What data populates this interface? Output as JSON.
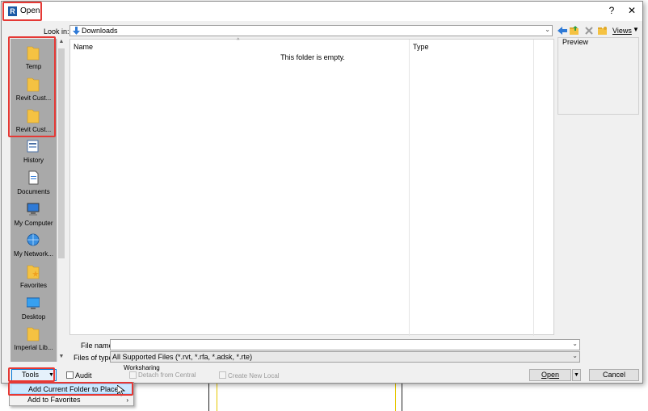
{
  "dialog": {
    "title": "Open",
    "app_icon_letter": "R",
    "help_glyph": "?",
    "close_glyph": "✕"
  },
  "lookin": {
    "label": "Look in:",
    "value": "Downloads"
  },
  "toolbar": {
    "views_label": "Views"
  },
  "places": [
    {
      "label": "Temp",
      "icon": "folder-icon"
    },
    {
      "label": "Revit Cust...",
      "icon": "folder-icon"
    },
    {
      "label": "Revit Cust...",
      "icon": "folder-icon"
    },
    {
      "label": "History",
      "icon": "history-icon"
    },
    {
      "label": "Documents",
      "icon": "documents-icon"
    },
    {
      "label": "My Computer",
      "icon": "computer-icon"
    },
    {
      "label": "My Network...",
      "icon": "network-icon"
    },
    {
      "label": "Favorites",
      "icon": "favorites-icon"
    },
    {
      "label": "Desktop",
      "icon": "desktop-icon"
    },
    {
      "label": "Imperial Lib...",
      "icon": "folder-icon"
    }
  ],
  "filelist": {
    "col_name": "Name",
    "col_type": "Type",
    "empty_message": "This folder is empty."
  },
  "preview": {
    "label": "Preview"
  },
  "filename": {
    "label": "File name:",
    "value": ""
  },
  "filetype": {
    "label": "Files of type:",
    "value": "All Supported Files  (*.rvt, *.rfa, *.adsk, *.rte)"
  },
  "worksharing": {
    "label": "Worksharing",
    "detach_label": "Detach from Central",
    "create_local_label": "Create New Local"
  },
  "bottom": {
    "tools_label": "Tools",
    "audit_label": "Audit",
    "open_label": "Open",
    "cancel_label": "Cancel"
  },
  "tools_menu": [
    {
      "label": "Add Current Folder to Places",
      "selected": true
    },
    {
      "label": "Add to Favorites",
      "selected": false
    }
  ],
  "colors": {
    "highlight": "#e53935",
    "places_bg": "#a9a9a9",
    "accent_blue": "#1c5aa6",
    "folder_yellow": "#f5c242"
  }
}
